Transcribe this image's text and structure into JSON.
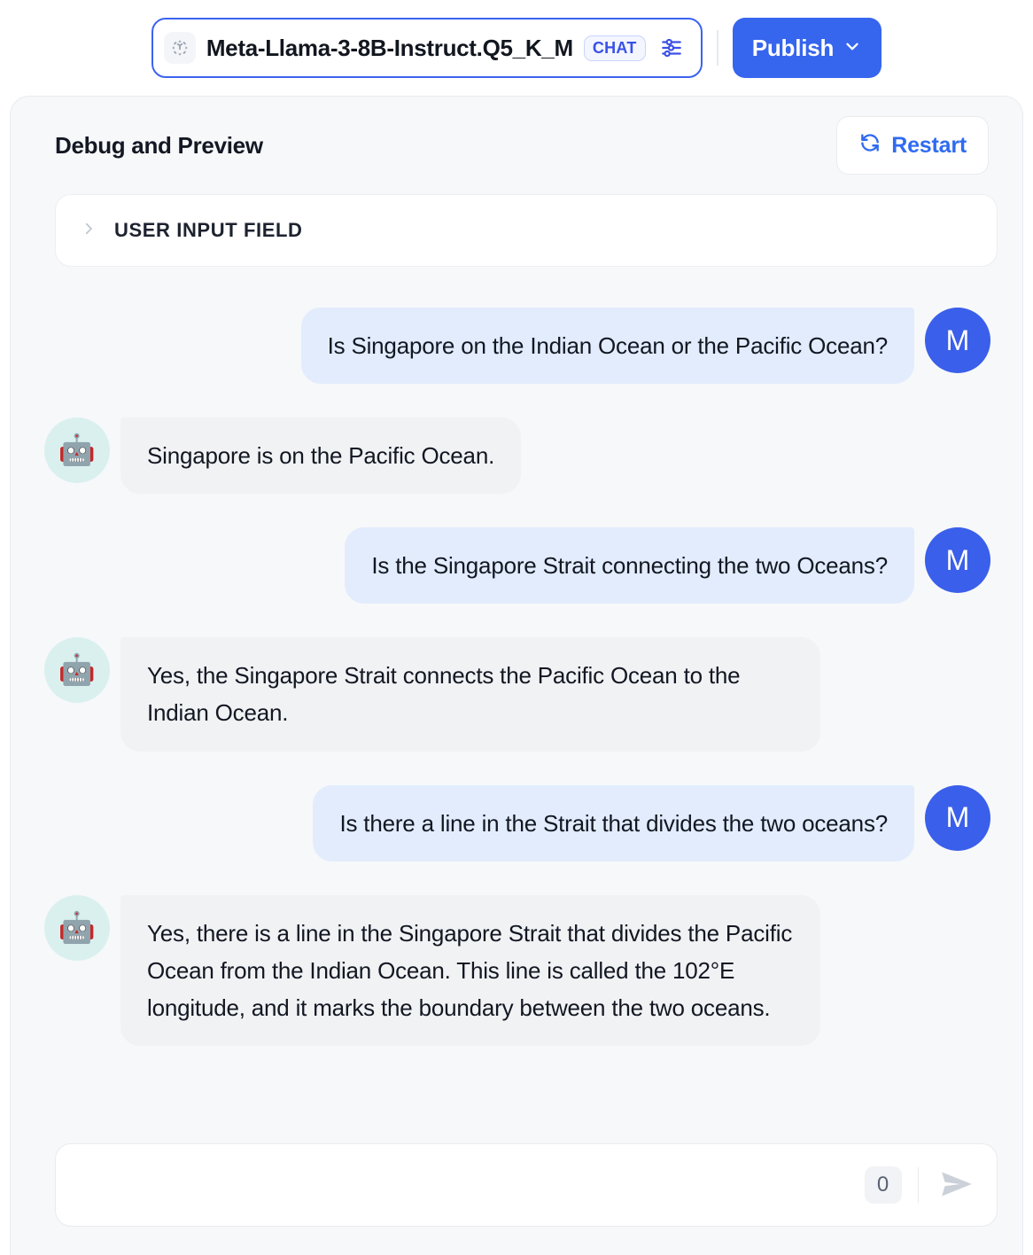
{
  "topbar": {
    "model_icon": "3d-model-icon",
    "model_name": "Meta-Llama-3-8B-Instruct.Q5_K_M",
    "mode_badge": "CHAT",
    "settings_icon": "sliders-icon",
    "publish_label": "Publish",
    "publish_chevron": "chevron-down-icon",
    "accent_color": "#3665ee",
    "badge_color": "#3b50e8"
  },
  "panel": {
    "title": "Debug and Preview",
    "restart_label": "Restart",
    "restart_icon": "refresh-icon",
    "restart_color": "#2f6bf0",
    "user_input_field": {
      "label": "USER INPUT FIELD",
      "chevron": "chevron-right-icon"
    }
  },
  "chat": {
    "user_avatar_initial": "M",
    "user_avatar_color": "#3a5fea",
    "bot_avatar_icon": "robot-icon",
    "bot_avatar_glyph": "🤖",
    "bot_avatar_color": "#d9f0ef",
    "user_bubble_color": "#e2ecfc",
    "bot_bubble_color": "#f1f2f4",
    "messages": [
      {
        "role": "user",
        "text": "Is Singapore on the Indian Ocean or the Pacific Ocean?"
      },
      {
        "role": "bot",
        "text": "Singapore is on the Pacific Ocean."
      },
      {
        "role": "user",
        "text": "Is the Singapore Strait connecting the two Oceans?"
      },
      {
        "role": "bot",
        "text": "Yes, the Singapore Strait connects the Pacific Ocean to the Indian Ocean."
      },
      {
        "role": "user",
        "text": "Is there a line in the Strait that divides the two oceans?"
      },
      {
        "role": "bot",
        "text": "Yes, there is a line in the Singapore Strait that divides the Pacific Ocean from the Indian Ocean. This line is called the 102°E longitude, and it marks the boundary between the two oceans."
      }
    ]
  },
  "composer": {
    "value": "",
    "placeholder": "",
    "char_count": "0",
    "send_icon": "send-icon"
  }
}
